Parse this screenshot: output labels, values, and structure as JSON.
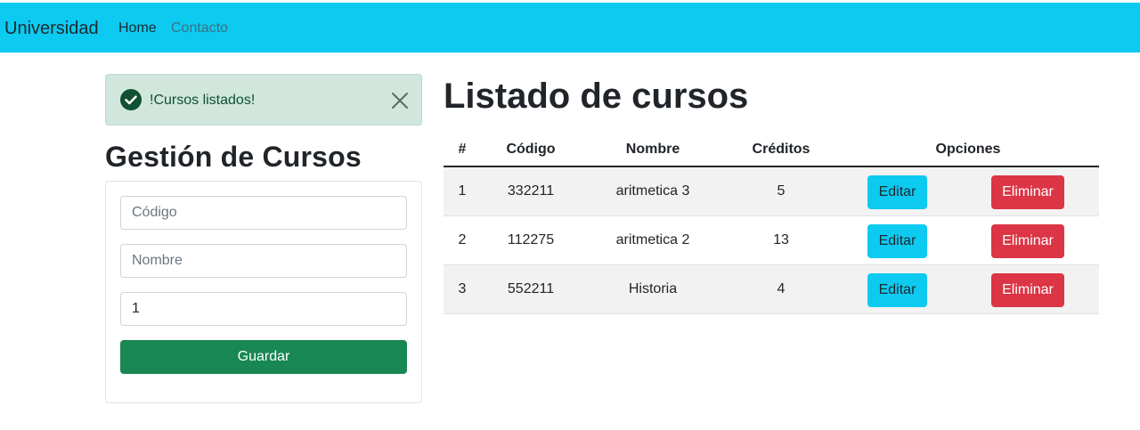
{
  "navbar": {
    "brand": "Universidad",
    "links": [
      {
        "label": "Home"
      },
      {
        "label": "Contacto"
      }
    ],
    "color": "#0dcaf0"
  },
  "alert": {
    "message": "!Cursos listados!",
    "icon": "check-circle-icon",
    "close_icon": "close-icon",
    "color": "#d1e7dd"
  },
  "form": {
    "title": "Gestión de Cursos",
    "codigo_placeholder": "Código",
    "nombre_placeholder": "Nombre",
    "creditos_value": "1",
    "submit_label": "Guardar",
    "submit_color": "#198754"
  },
  "list": {
    "title": "Listado de cursos",
    "headers": [
      "#",
      "Código",
      "Nombre",
      "Créditos",
      "Opciones"
    ],
    "rows": [
      {
        "num": "1",
        "codigo": "332211",
        "nombre": "aritmetica 3",
        "creditos": "5",
        "edit": "Editar",
        "delete": "Eliminar"
      },
      {
        "num": "2",
        "codigo": "112275",
        "nombre": "aritmetica 2",
        "creditos": "13",
        "edit": "Editar",
        "delete": "Eliminar"
      },
      {
        "num": "3",
        "codigo": "552211",
        "nombre": "Historia",
        "creditos": "4",
        "edit": "Editar",
        "delete": "Eliminar"
      }
    ],
    "edit_color": "#0dcaf0",
    "delete_color": "#dc3545"
  }
}
